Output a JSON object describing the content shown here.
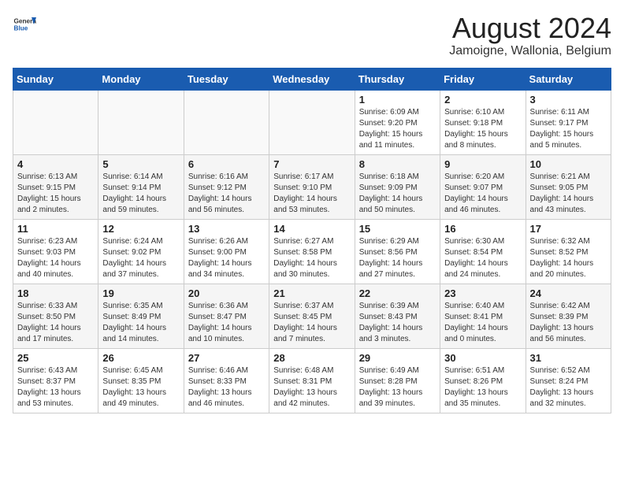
{
  "header": {
    "logo_general": "General",
    "logo_blue": "Blue",
    "month_title": "August 2024",
    "location": "Jamoigne, Wallonia, Belgium"
  },
  "weekdays": [
    "Sunday",
    "Monday",
    "Tuesday",
    "Wednesday",
    "Thursday",
    "Friday",
    "Saturday"
  ],
  "weeks": [
    [
      {
        "day": "",
        "info": ""
      },
      {
        "day": "",
        "info": ""
      },
      {
        "day": "",
        "info": ""
      },
      {
        "day": "",
        "info": ""
      },
      {
        "day": "1",
        "info": "Sunrise: 6:09 AM\nSunset: 9:20 PM\nDaylight: 15 hours\nand 11 minutes."
      },
      {
        "day": "2",
        "info": "Sunrise: 6:10 AM\nSunset: 9:18 PM\nDaylight: 15 hours\nand 8 minutes."
      },
      {
        "day": "3",
        "info": "Sunrise: 6:11 AM\nSunset: 9:17 PM\nDaylight: 15 hours\nand 5 minutes."
      }
    ],
    [
      {
        "day": "4",
        "info": "Sunrise: 6:13 AM\nSunset: 9:15 PM\nDaylight: 15 hours\nand 2 minutes."
      },
      {
        "day": "5",
        "info": "Sunrise: 6:14 AM\nSunset: 9:14 PM\nDaylight: 14 hours\nand 59 minutes."
      },
      {
        "day": "6",
        "info": "Sunrise: 6:16 AM\nSunset: 9:12 PM\nDaylight: 14 hours\nand 56 minutes."
      },
      {
        "day": "7",
        "info": "Sunrise: 6:17 AM\nSunset: 9:10 PM\nDaylight: 14 hours\nand 53 minutes."
      },
      {
        "day": "8",
        "info": "Sunrise: 6:18 AM\nSunset: 9:09 PM\nDaylight: 14 hours\nand 50 minutes."
      },
      {
        "day": "9",
        "info": "Sunrise: 6:20 AM\nSunset: 9:07 PM\nDaylight: 14 hours\nand 46 minutes."
      },
      {
        "day": "10",
        "info": "Sunrise: 6:21 AM\nSunset: 9:05 PM\nDaylight: 14 hours\nand 43 minutes."
      }
    ],
    [
      {
        "day": "11",
        "info": "Sunrise: 6:23 AM\nSunset: 9:03 PM\nDaylight: 14 hours\nand 40 minutes."
      },
      {
        "day": "12",
        "info": "Sunrise: 6:24 AM\nSunset: 9:02 PM\nDaylight: 14 hours\nand 37 minutes."
      },
      {
        "day": "13",
        "info": "Sunrise: 6:26 AM\nSunset: 9:00 PM\nDaylight: 14 hours\nand 34 minutes."
      },
      {
        "day": "14",
        "info": "Sunrise: 6:27 AM\nSunset: 8:58 PM\nDaylight: 14 hours\nand 30 minutes."
      },
      {
        "day": "15",
        "info": "Sunrise: 6:29 AM\nSunset: 8:56 PM\nDaylight: 14 hours\nand 27 minutes."
      },
      {
        "day": "16",
        "info": "Sunrise: 6:30 AM\nSunset: 8:54 PM\nDaylight: 14 hours\nand 24 minutes."
      },
      {
        "day": "17",
        "info": "Sunrise: 6:32 AM\nSunset: 8:52 PM\nDaylight: 14 hours\nand 20 minutes."
      }
    ],
    [
      {
        "day": "18",
        "info": "Sunrise: 6:33 AM\nSunset: 8:50 PM\nDaylight: 14 hours\nand 17 minutes."
      },
      {
        "day": "19",
        "info": "Sunrise: 6:35 AM\nSunset: 8:49 PM\nDaylight: 14 hours\nand 14 minutes."
      },
      {
        "day": "20",
        "info": "Sunrise: 6:36 AM\nSunset: 8:47 PM\nDaylight: 14 hours\nand 10 minutes."
      },
      {
        "day": "21",
        "info": "Sunrise: 6:37 AM\nSunset: 8:45 PM\nDaylight: 14 hours\nand 7 minutes."
      },
      {
        "day": "22",
        "info": "Sunrise: 6:39 AM\nSunset: 8:43 PM\nDaylight: 14 hours\nand 3 minutes."
      },
      {
        "day": "23",
        "info": "Sunrise: 6:40 AM\nSunset: 8:41 PM\nDaylight: 14 hours\nand 0 minutes."
      },
      {
        "day": "24",
        "info": "Sunrise: 6:42 AM\nSunset: 8:39 PM\nDaylight: 13 hours\nand 56 minutes."
      }
    ],
    [
      {
        "day": "25",
        "info": "Sunrise: 6:43 AM\nSunset: 8:37 PM\nDaylight: 13 hours\nand 53 minutes."
      },
      {
        "day": "26",
        "info": "Sunrise: 6:45 AM\nSunset: 8:35 PM\nDaylight: 13 hours\nand 49 minutes."
      },
      {
        "day": "27",
        "info": "Sunrise: 6:46 AM\nSunset: 8:33 PM\nDaylight: 13 hours\nand 46 minutes."
      },
      {
        "day": "28",
        "info": "Sunrise: 6:48 AM\nSunset: 8:31 PM\nDaylight: 13 hours\nand 42 minutes."
      },
      {
        "day": "29",
        "info": "Sunrise: 6:49 AM\nSunset: 8:28 PM\nDaylight: 13 hours\nand 39 minutes."
      },
      {
        "day": "30",
        "info": "Sunrise: 6:51 AM\nSunset: 8:26 PM\nDaylight: 13 hours\nand 35 minutes."
      },
      {
        "day": "31",
        "info": "Sunrise: 6:52 AM\nSunset: 8:24 PM\nDaylight: 13 hours\nand 32 minutes."
      }
    ]
  ]
}
